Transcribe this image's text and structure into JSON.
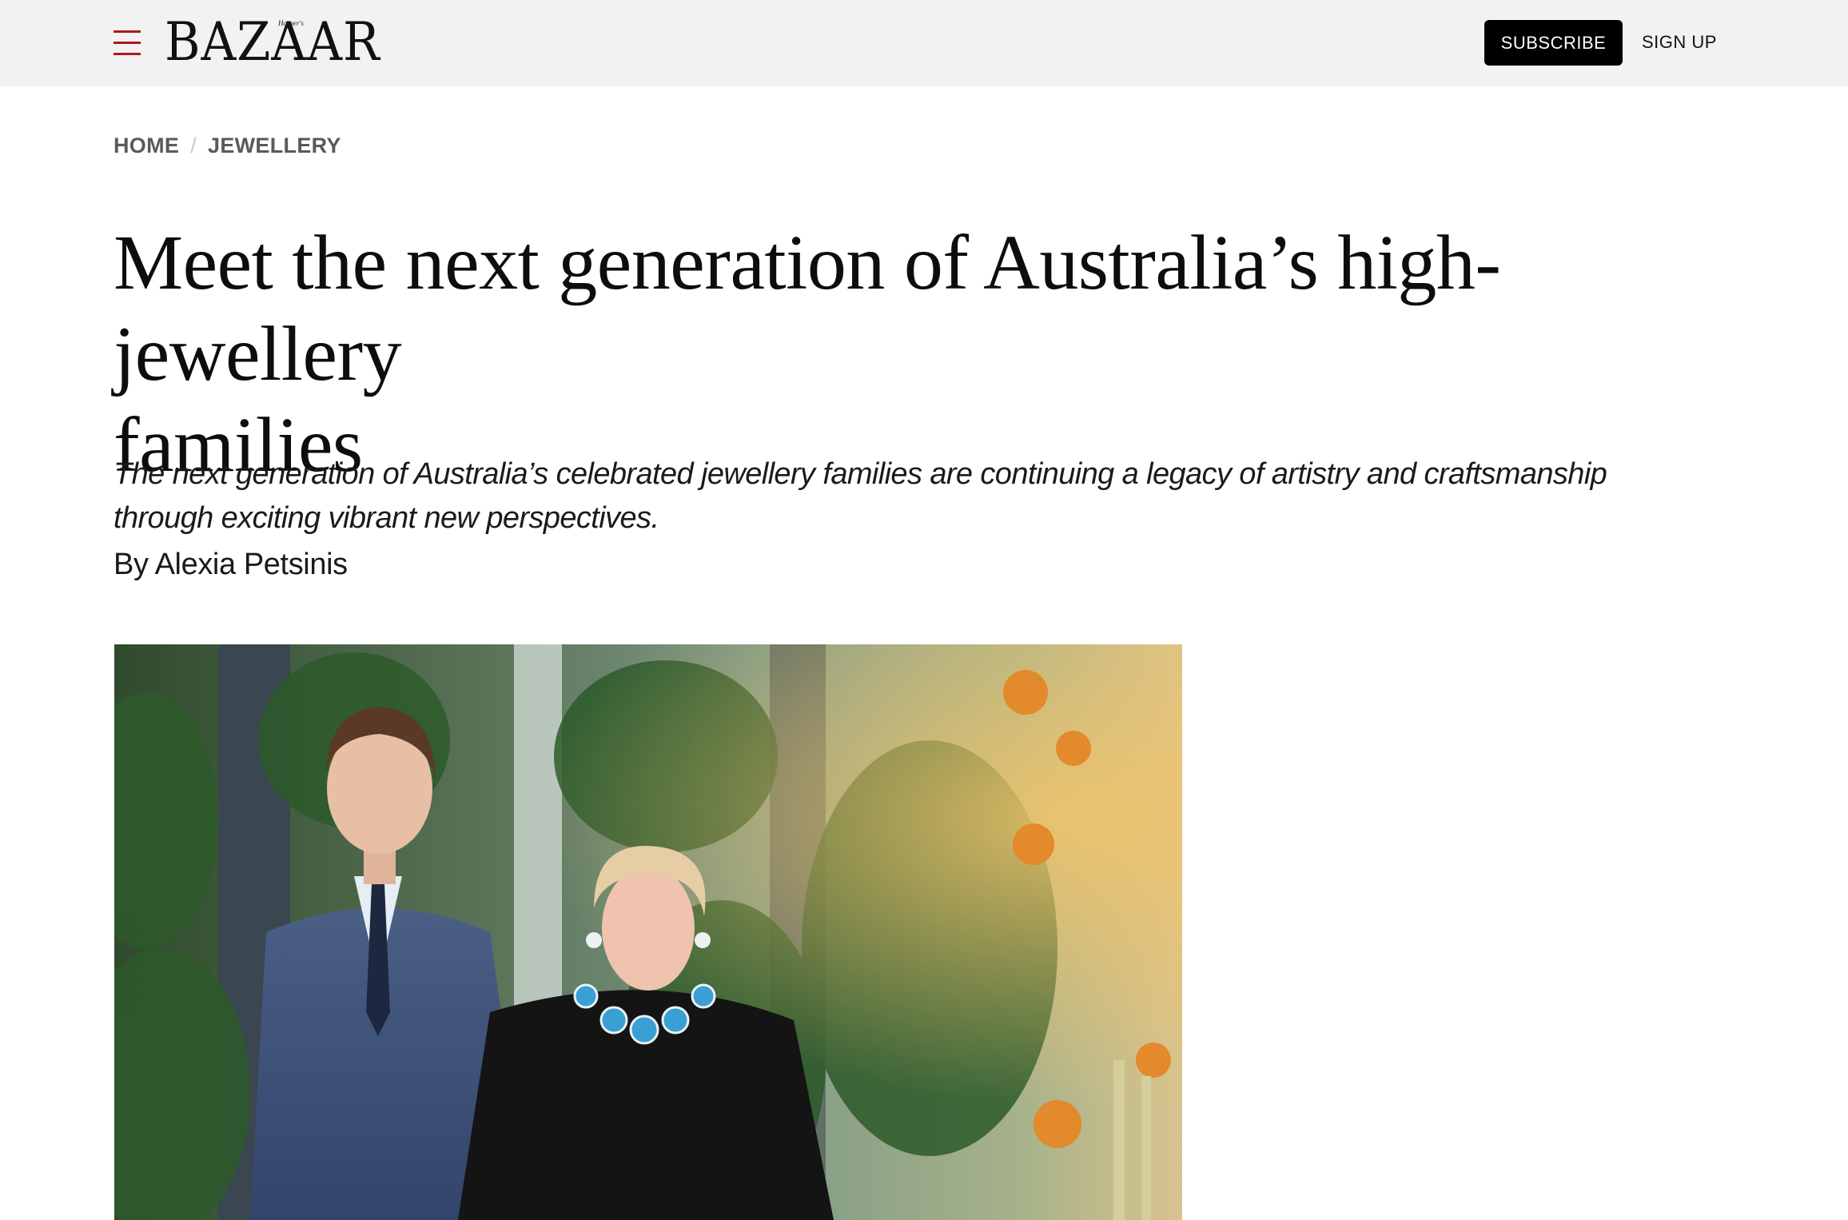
{
  "header": {
    "logo_text": "BAZAAR",
    "logo_small": "Harper's",
    "subscribe_label": "SUBSCRIBE",
    "signup_label": "SIGN UP",
    "menu_icon": "hamburger-menu-icon"
  },
  "breadcrumb": {
    "items": [
      "HOME",
      "JEWELLERY"
    ],
    "separator": "/"
  },
  "article": {
    "headline_line1": "Meet the next generation of Australia’s high-jewellery",
    "headline_line2": "families",
    "dek_line1": "The next generation of Australia’s celebrated jewellery families are continuing a legacy of artistry and craftsmanship",
    "dek_line2": "through exciting vibrant new perspectives.",
    "byline": "By Alexia Petsinis"
  },
  "colors": {
    "accent_red": "#b0171f",
    "header_bg": "#f2f2f2",
    "button_bg": "#000000"
  }
}
